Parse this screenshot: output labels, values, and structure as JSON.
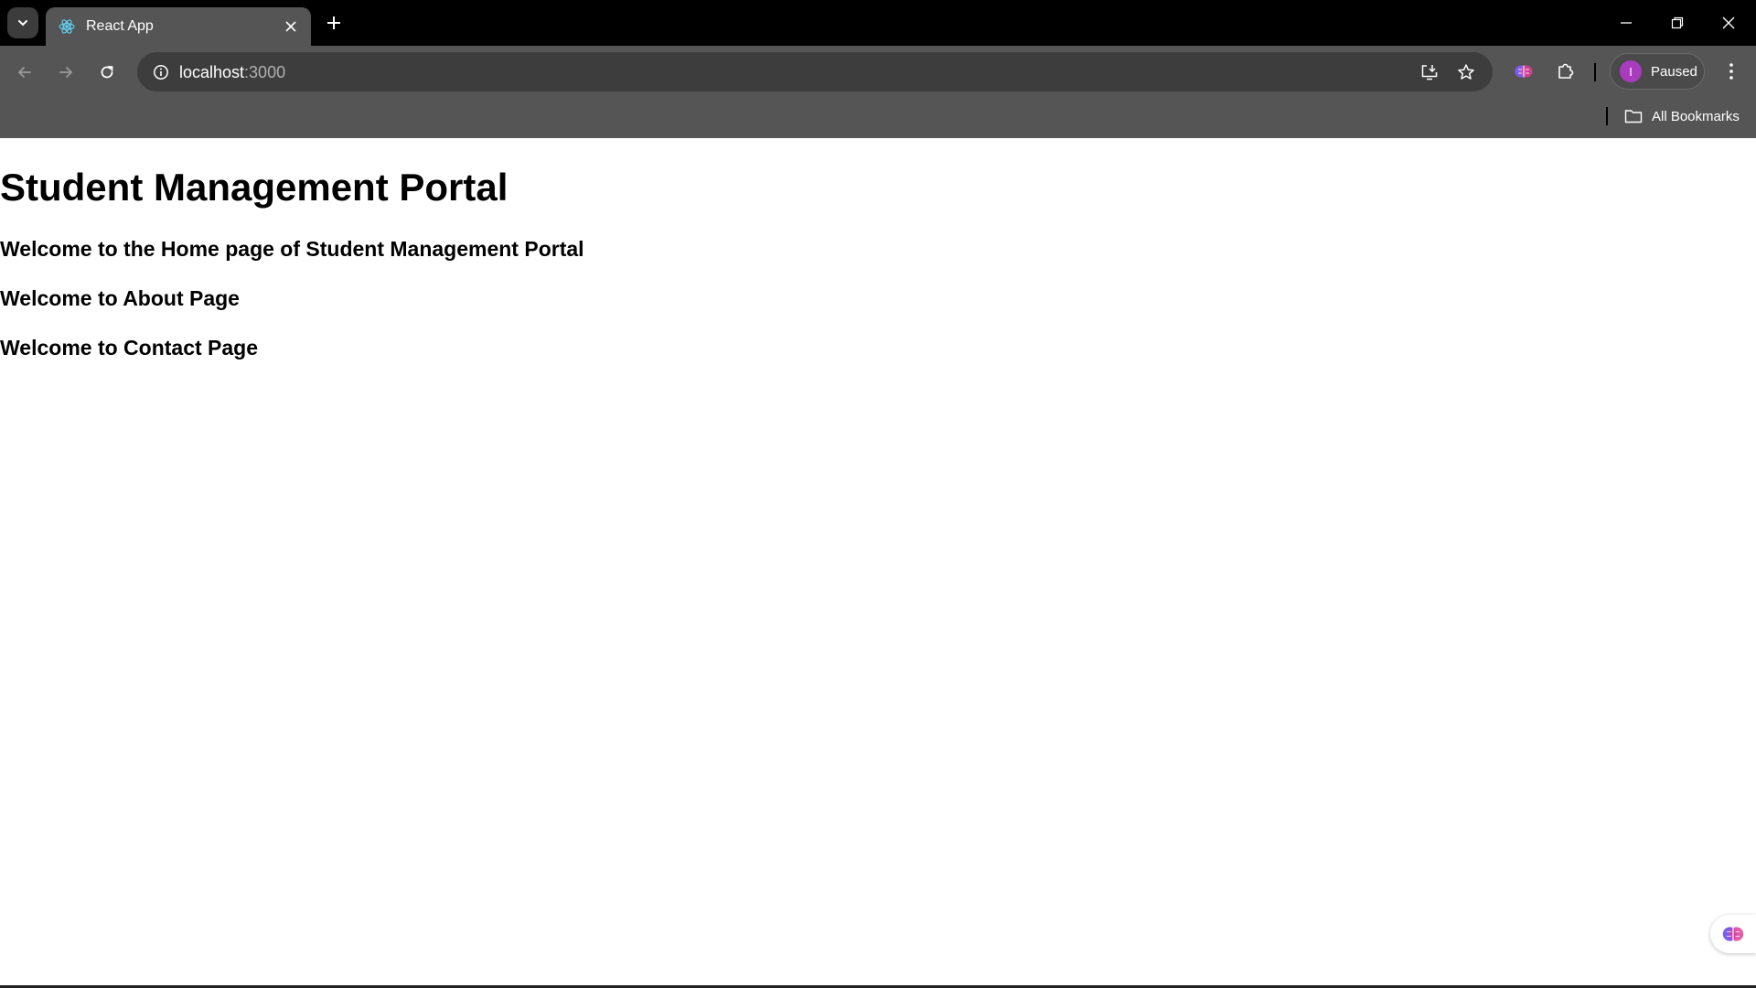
{
  "browser": {
    "tab": {
      "title": "React App"
    },
    "address": {
      "host": "localhost",
      "port": ":3000"
    },
    "profile": {
      "initial": "I",
      "label": "Paused"
    },
    "bookmarks": {
      "all_label": "All Bookmarks"
    }
  },
  "page": {
    "heading": "Student Management Portal",
    "sections": [
      "Welcome to the Home page of Student Management Portal",
      "Welcome to About Page",
      "Welcome to Contact Page"
    ]
  },
  "colors": {
    "tabstrip": "#000000",
    "toolbar": "#555555",
    "omnibox": "#3d3d3d",
    "avatar": "#a93bbf"
  }
}
